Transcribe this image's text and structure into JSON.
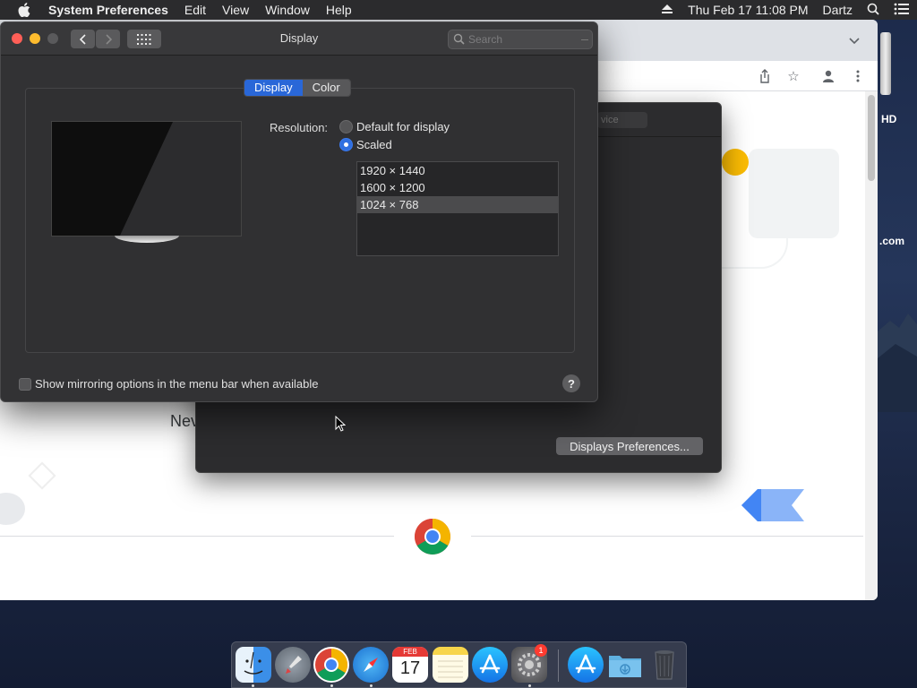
{
  "menubar": {
    "app_name": "System Preferences",
    "items": [
      "Edit",
      "View",
      "Window",
      "Help"
    ],
    "clock": "Thu Feb 17  11:08 PM",
    "user": "Dartz"
  },
  "desktop": {
    "hd_label": "HD",
    "com_label": ".com"
  },
  "chrome": {
    "partial_text": "Nev"
  },
  "secondary_panel": {
    "ghost_pill": "vice",
    "button_label": "Displays Preferences..."
  },
  "window": {
    "title": "Display",
    "search_placeholder": "Search",
    "tabs": [
      {
        "label": "Display",
        "active": true
      },
      {
        "label": "Color",
        "active": false
      }
    ],
    "resolution_label": "Resolution:",
    "options": [
      {
        "label": "Default for display",
        "selected": false
      },
      {
        "label": "Scaled",
        "selected": true
      }
    ],
    "resolutions": [
      "1920 × 1440",
      "1600 × 1200",
      "1024 × 768"
    ],
    "selected_resolution": "1024 × 768",
    "mirroring_label": "Show mirroring options in the menu bar when available",
    "mirroring_checked": false,
    "help_label": "?"
  },
  "dock": {
    "apps": [
      "Finder",
      "Launchpad",
      "Google Chrome",
      "Safari",
      "Calendar",
      "Notes",
      "App Store",
      "System Preferences",
      "App Store",
      "Downloads",
      "Trash"
    ],
    "calendar_month": "FEB",
    "calendar_day": "17",
    "sysprefs_badge": "1"
  },
  "colors": {
    "accent": "#2967d8",
    "window_bg": "#323234",
    "badge": "#ff3b30"
  }
}
